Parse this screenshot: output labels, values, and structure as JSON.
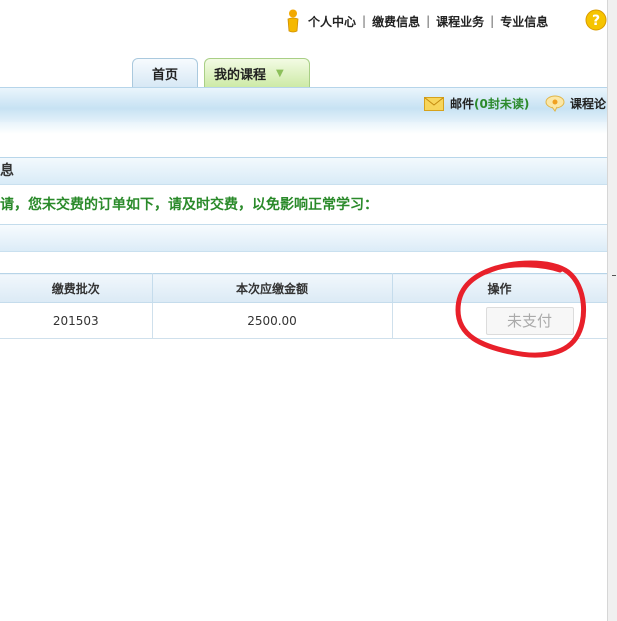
{
  "topnav": {
    "links": [
      "个人中心",
      "缴费信息",
      "课程业务",
      "专业信息"
    ],
    "separator": "|"
  },
  "tabs": [
    {
      "label": "首页"
    },
    {
      "label": "我的课程",
      "arrow": "▼"
    }
  ],
  "header": {
    "mail_label": "邮件",
    "mail_count": "(0封未读)",
    "forum_label": "课程论"
  },
  "section": {
    "title": "息",
    "notice": "请，您未交费的订单如下，请及时交费，以免影响正常学习："
  },
  "table": {
    "columns": [
      "缴费批次",
      "本次应缴金额",
      "操作"
    ],
    "rows": [
      {
        "batch": "201503",
        "amount": "2500.00",
        "action": "未支付"
      }
    ]
  },
  "colors": {
    "notice_green": "#2a8a2a",
    "annotation_red": "#e8202a",
    "header_blue": "#c7e2f3"
  },
  "icons": [
    "person-icon",
    "help-icon",
    "mail-icon",
    "forum-icon"
  ]
}
